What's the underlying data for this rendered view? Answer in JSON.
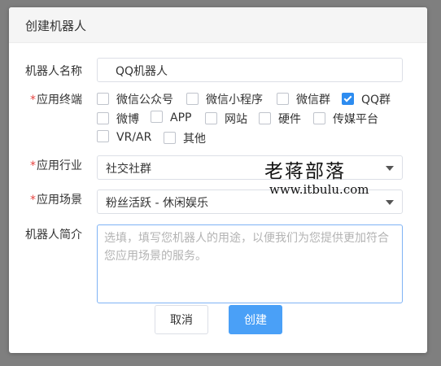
{
  "dialog": {
    "title": "创建机器人"
  },
  "form": {
    "name": {
      "label": "机器人名称",
      "value": "QQ机器人"
    },
    "terminal": {
      "required_mark": "*",
      "label": "应用终端",
      "options": [
        {
          "label": "微信公众号",
          "checked": false
        },
        {
          "label": "微信小程序",
          "checked": false
        },
        {
          "label": "微信群",
          "checked": false
        },
        {
          "label": "QQ群",
          "checked": true
        },
        {
          "label": "微博",
          "checked": false
        },
        {
          "label": "APP",
          "checked": false
        },
        {
          "label": "网站",
          "checked": false
        },
        {
          "label": "硬件",
          "checked": false
        },
        {
          "label": "传媒平台",
          "checked": false
        },
        {
          "label": "VR/AR",
          "checked": false
        },
        {
          "label": "其他",
          "checked": false
        }
      ]
    },
    "industry": {
      "required_mark": "*",
      "label": "应用行业",
      "value": "社交社群"
    },
    "scene": {
      "required_mark": "*",
      "label": "应用场景",
      "value": "粉丝活跃 - 休闲娱乐"
    },
    "intro": {
      "label": "机器人简介",
      "placeholder": "选填，填写您机器人的用途，以便我们为您提供更加符合您应用场景的服务。"
    }
  },
  "buttons": {
    "cancel": "取消",
    "create": "创建"
  },
  "watermark": {
    "title": "老蒋部落",
    "url": "www.itbulu.com"
  },
  "colors": {
    "primary": "#4aa0f7",
    "checkbox_checked": "#2d8cf0",
    "required": "#e64340"
  }
}
